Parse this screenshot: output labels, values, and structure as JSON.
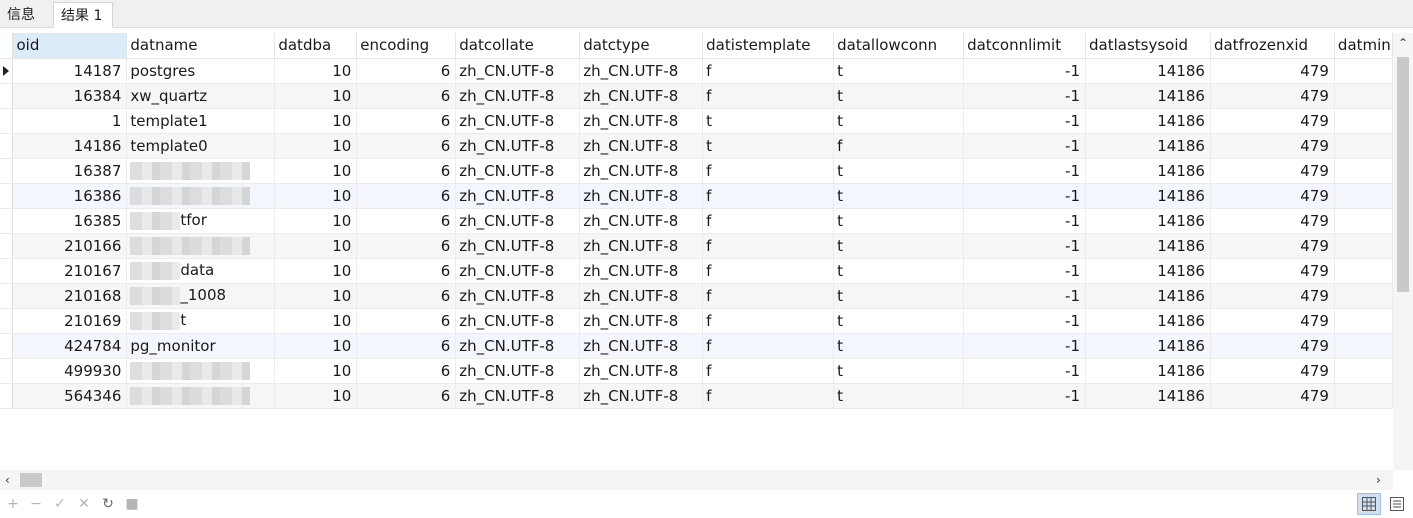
{
  "tabs": [
    "信息",
    "结果 1"
  ],
  "columns": [
    "oid",
    "datname",
    "datdba",
    "encoding",
    "datcollate",
    "datctype",
    "datistemplate",
    "datallowconn",
    "datconnlimit",
    "datlastsysoid",
    "datfrozenxid",
    "datmin"
  ],
  "rows": [
    [
      "14187",
      "postgres",
      "10",
      "6",
      "zh_CN.UTF-8",
      "zh_CN.UTF-8",
      "f",
      "t",
      "-1",
      "14186",
      "479",
      ""
    ],
    [
      "16384",
      "xw_quartz",
      "10",
      "6",
      "zh_CN.UTF-8",
      "zh_CN.UTF-8",
      "f",
      "t",
      "-1",
      "14186",
      "479",
      ""
    ],
    [
      "1",
      "template1",
      "10",
      "6",
      "zh_CN.UTF-8",
      "zh_CN.UTF-8",
      "t",
      "t",
      "-1",
      "14186",
      "479",
      ""
    ],
    [
      "14186",
      "template0",
      "10",
      "6",
      "zh_CN.UTF-8",
      "zh_CN.UTF-8",
      "t",
      "f",
      "-1",
      "14186",
      "479",
      ""
    ],
    [
      "16387",
      "",
      "10",
      "6",
      "zh_CN.UTF-8",
      "zh_CN.UTF-8",
      "f",
      "t",
      "-1",
      "14186",
      "479",
      ""
    ],
    [
      "16386",
      "",
      "10",
      "6",
      "zh_CN.UTF-8",
      "zh_CN.UTF-8",
      "f",
      "t",
      "-1",
      "14186",
      "479",
      ""
    ],
    [
      "16385",
      "tfor",
      "10",
      "6",
      "zh_CN.UTF-8",
      "zh_CN.UTF-8",
      "f",
      "t",
      "-1",
      "14186",
      "479",
      ""
    ],
    [
      "210166",
      "",
      "10",
      "6",
      "zh_CN.UTF-8",
      "zh_CN.UTF-8",
      "f",
      "t",
      "-1",
      "14186",
      "479",
      ""
    ],
    [
      "210167",
      "data",
      "10",
      "6",
      "zh_CN.UTF-8",
      "zh_CN.UTF-8",
      "f",
      "t",
      "-1",
      "14186",
      "479",
      ""
    ],
    [
      "210168",
      "_1008",
      "10",
      "6",
      "zh_CN.UTF-8",
      "zh_CN.UTF-8",
      "f",
      "t",
      "-1",
      "14186",
      "479",
      ""
    ],
    [
      "210169",
      "t",
      "10",
      "6",
      "zh_CN.UTF-8",
      "zh_CN.UTF-8",
      "f",
      "t",
      "-1",
      "14186",
      "479",
      ""
    ],
    [
      "424784",
      "pg_monitor",
      "10",
      "6",
      "zh_CN.UTF-8",
      "zh_CN.UTF-8",
      "f",
      "t",
      "-1",
      "14186",
      "479",
      ""
    ],
    [
      "499930",
      "",
      "10",
      "6",
      "zh_CN.UTF-8",
      "zh_CN.UTF-8",
      "f",
      "t",
      "-1",
      "14186",
      "479",
      ""
    ],
    [
      "564346",
      "",
      "10",
      "6",
      "zh_CN.UTF-8",
      "zh_CN.UTF-8",
      "f",
      "t",
      "-1",
      "14186",
      "479",
      ""
    ]
  ],
  "redacted_name_rows": [
    4,
    5,
    6,
    7,
    8,
    9,
    10,
    12,
    13
  ],
  "selected_row_index": 0,
  "toolbar_icons": [
    "add-icon",
    "remove-icon",
    "apply-icon",
    "discard-icon",
    "refresh-icon",
    "stop-icon"
  ],
  "view_modes": [
    "grid-view-icon",
    "form-view-icon"
  ]
}
